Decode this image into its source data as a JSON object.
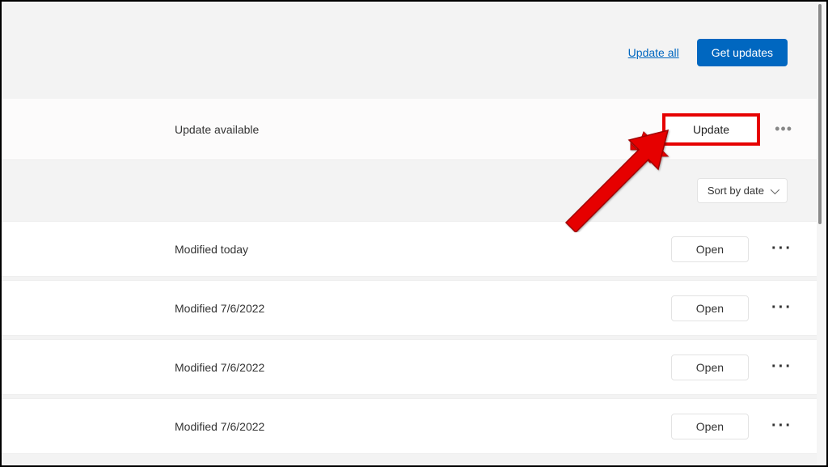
{
  "header": {
    "update_all_label": "Update all",
    "get_updates_label": "Get updates"
  },
  "update_item": {
    "status": "Update available",
    "button_label": "Update"
  },
  "sort": {
    "label": "Sort by date"
  },
  "items": [
    {
      "modified": "Modified today",
      "action_label": "Open"
    },
    {
      "modified": "Modified 7/6/2022",
      "action_label": "Open"
    },
    {
      "modified": "Modified 7/6/2022",
      "action_label": "Open"
    },
    {
      "modified": "Modified 7/6/2022",
      "action_label": "Open"
    }
  ],
  "annotation": {
    "highlight_color": "#e60000"
  }
}
